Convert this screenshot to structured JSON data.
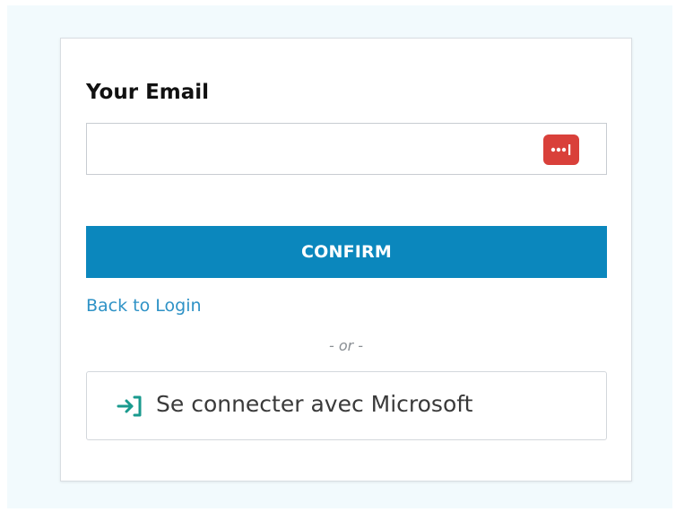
{
  "form": {
    "email_label": "Your Email",
    "email_value": "",
    "email_placeholder": "",
    "confirm_label": "CONFIRM",
    "back_link_label": "Back to Login",
    "divider_text": "- or -",
    "microsoft_button_label": "Se connecter avec Microsoft"
  },
  "icons": {
    "password_manager": "password-manager-icon",
    "login": "login-arrow-icon"
  },
  "colors": {
    "primary": "#0b87bd",
    "link": "#2e92c6",
    "password_manager": "#d9403a",
    "login_icon": "#1a9a8e",
    "background": "#f2fafd"
  }
}
